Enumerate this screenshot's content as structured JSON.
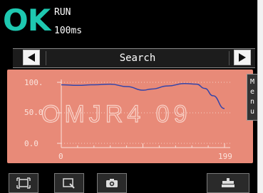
{
  "status": {
    "result": "OK",
    "mode": "RUN",
    "cycle_time": "100ms"
  },
  "nav": {
    "title": "Search",
    "prev_icon": "triangle-left-icon",
    "next_icon": "triangle-right-icon"
  },
  "menu": {
    "letters": [
      "M",
      "e",
      "n",
      "u"
    ]
  },
  "plot": {
    "overlay_text": "OMJR4  09",
    "y_labels": [
      "100.",
      "50.0",
      "0.0"
    ],
    "x_labels": [
      "0",
      "199"
    ],
    "line_color": "#3344aa",
    "background_color": "#e88a78"
  },
  "chart_data": {
    "type": "line",
    "x_range": [
      0,
      199
    ],
    "y_range": [
      0,
      100
    ],
    "series": [
      {
        "x": [
          0,
          20,
          40,
          60,
          80,
          100,
          110,
          130,
          150,
          165,
          175,
          185,
          199
        ],
        "y": [
          96,
          95,
          96,
          97,
          93,
          87,
          89,
          94,
          98,
          97,
          90,
          78,
          57
        ]
      }
    ],
    "grid": false
  },
  "toolbar": {
    "buttons": [
      "fit-screen-icon",
      "zoom-icon",
      "camera-icon",
      "settings-icon"
    ]
  },
  "colors": {
    "ok": "#1ec8b0",
    "panel": "#000000",
    "plot_bg": "#e88a78"
  }
}
